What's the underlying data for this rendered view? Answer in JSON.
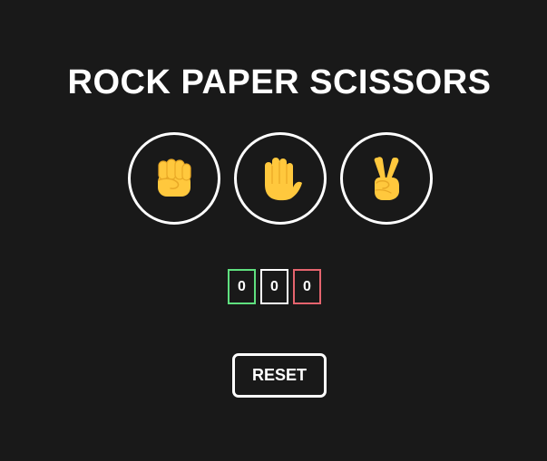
{
  "game": {
    "title": "ROCK PAPER SCISSORS"
  },
  "choices": [
    {
      "name": "rock",
      "icon": "raised-fist-icon"
    },
    {
      "name": "paper",
      "icon": "raised-hand-icon"
    },
    {
      "name": "scissors",
      "icon": "victory-hand-icon"
    }
  ],
  "scoreboard": {
    "wins": "0",
    "draws": "0",
    "losses": "0",
    "win_color": "#5fe07f",
    "draw_color": "#ffffff",
    "loss_color": "#e5646e"
  },
  "controls": {
    "reset_label": "RESET"
  },
  "theme": {
    "background": "#191919",
    "foreground": "#ffffff",
    "emoji_yellow": "#ffc83d",
    "emoji_shadow": "#e8a826"
  }
}
